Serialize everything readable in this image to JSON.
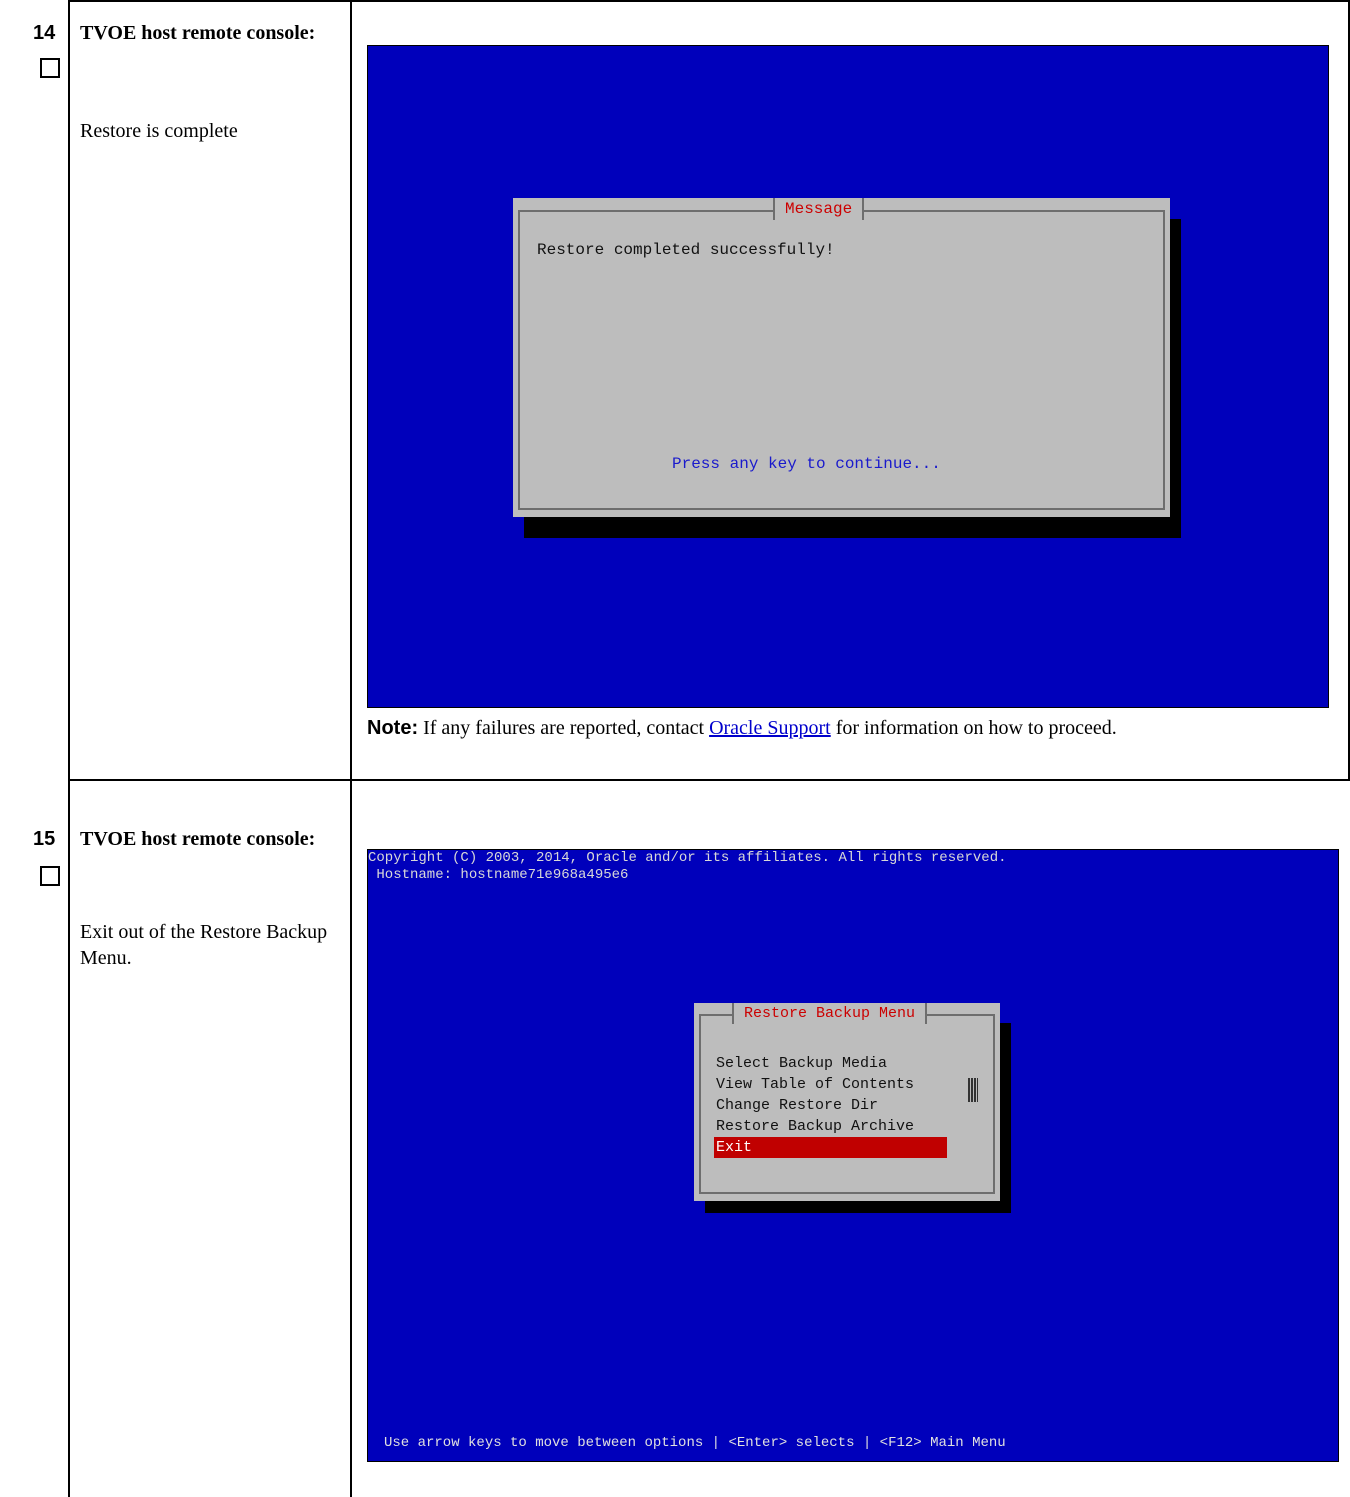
{
  "steps": [
    {
      "number": "14",
      "title": "TVOE host remote console:",
      "description": "Restore is complete",
      "terminal": {
        "dialog_title": "Message",
        "message": "Restore completed successfully!",
        "prompt": "Press any key to continue..."
      },
      "note": {
        "label": "Note:",
        "text_before": " If any failures are reported, contact ",
        "link": "Oracle Support",
        "text_after": " for information on how to proceed."
      }
    },
    {
      "number": "15",
      "title": "TVOE host remote console:",
      "description": "Exit out of the Restore Backup Menu.",
      "terminal": {
        "header_line1": "Copyright (C) 2003, 2014, Oracle and/or its affiliates. All rights reserved.",
        "header_line2": " Hostname: hostname71e968a495e6",
        "menu_title": "Restore Backup Menu",
        "menu_items": [
          "Select Backup Media",
          "View Table of Contents",
          "Change Restore Dir",
          "Restore Backup Archive",
          "Exit"
        ],
        "selected_item": "Exit",
        "footer": "Use arrow keys to move between options | <Enter> selects | <F12> Main Menu"
      }
    }
  ],
  "colors": {
    "terminal_bg": "#0000bb",
    "dialog_bg": "#bdbdbd",
    "dialog_title": "#cc0000",
    "selection": "#c00000",
    "link": "#0000cc"
  }
}
